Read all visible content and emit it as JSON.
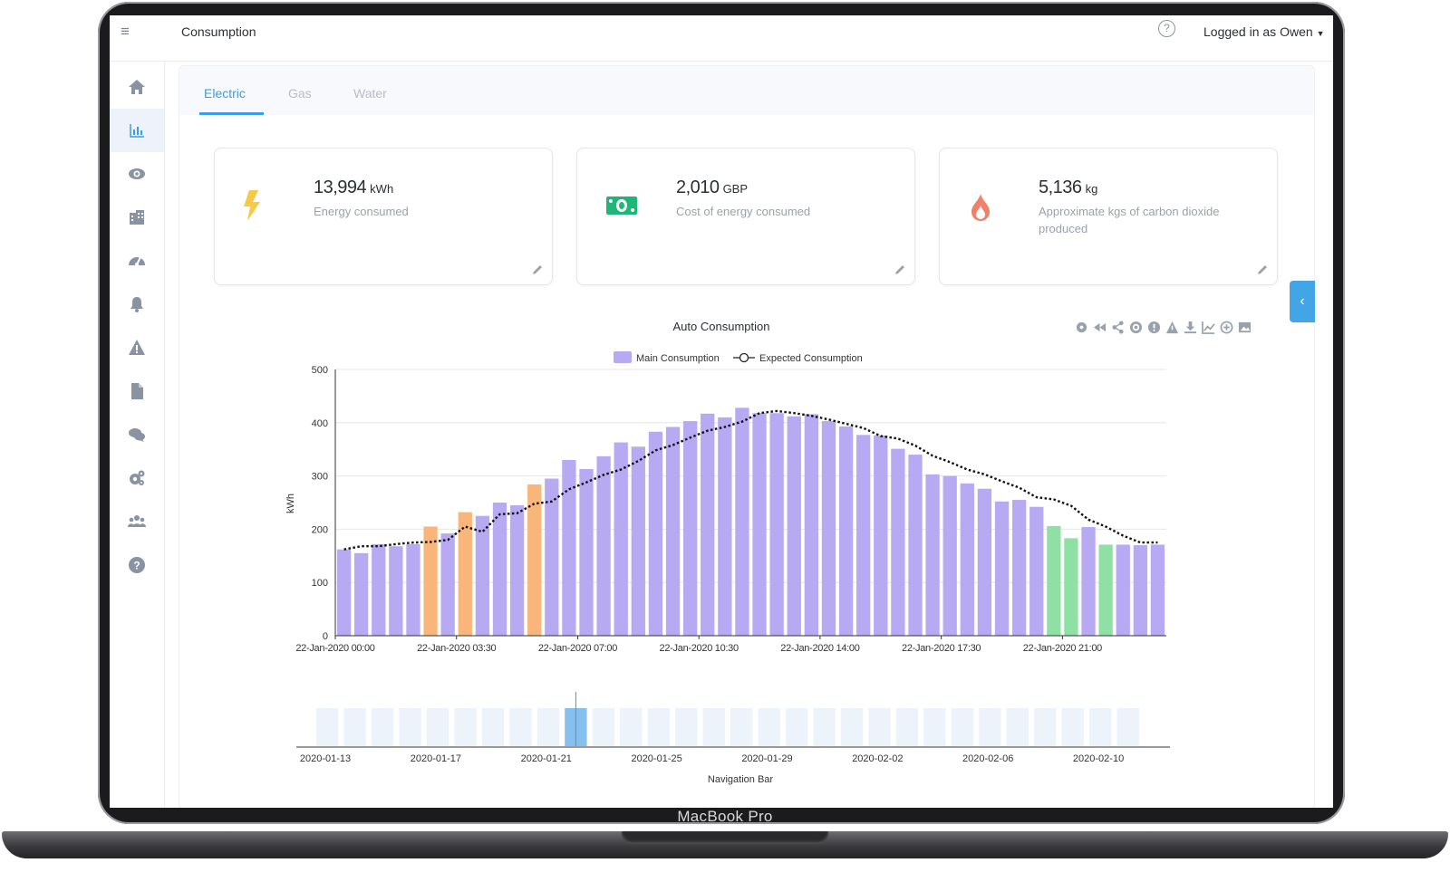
{
  "device": {
    "brand_label": "MacBook Pro"
  },
  "header": {
    "menu_icon": "hamburger-icon",
    "title": "Consumption",
    "help_icon": "help-circle-icon",
    "user_label": "Logged in as Owen"
  },
  "sidebar": {
    "items": [
      {
        "icon": "home-icon"
      },
      {
        "icon": "bar-chart-icon",
        "active": true
      },
      {
        "icon": "eye-icon"
      },
      {
        "icon": "building-icon"
      },
      {
        "icon": "dashboard-gauge-icon"
      },
      {
        "icon": "bell-icon"
      },
      {
        "icon": "warning-icon"
      },
      {
        "icon": "document-icon"
      },
      {
        "icon": "chat-icon"
      },
      {
        "icon": "cogs-icon"
      },
      {
        "icon": "users-icon"
      },
      {
        "icon": "question-icon"
      }
    ]
  },
  "tabs": [
    {
      "label": "Electric",
      "active": true
    },
    {
      "label": "Gas",
      "active": false
    },
    {
      "label": "Water",
      "active": false
    }
  ],
  "cards": [
    {
      "value": "13,994",
      "unit": "kWh",
      "label": "Energy consumed",
      "icon": "lightning-icon",
      "icon_color": "#f7c948"
    },
    {
      "value": "2,010",
      "unit": "GBP",
      "label": "Cost of energy consumed",
      "icon": "money-icon",
      "icon_color": "#1fb67a"
    },
    {
      "value": "5,136",
      "unit": "kg",
      "label": "Approximate kgs of carbon dioxide produced",
      "icon": "flame-icon",
      "icon_color": "#f0806a"
    }
  ],
  "colors": {
    "accent": "#3a9ee0",
    "bar_main": "#b7a9f2",
    "bar_orange": "#f8b67a",
    "bar_green": "#8ee0a4",
    "nav_bar": "#edf3fb",
    "nav_bar_selected": "#87c0ef"
  },
  "chart_data": {
    "type": "bar",
    "title": "Auto Consumption",
    "ylabel": "kWh",
    "ylim": [
      0,
      500
    ],
    "yticks": [
      0,
      100,
      200,
      300,
      400,
      500
    ],
    "legend": [
      "Main Consumption",
      "Expected Consumption"
    ],
    "x_tick_labels": [
      "22-Jan-2020 00:00",
      "22-Jan-2020 03:30",
      "22-Jan-2020 07:00",
      "22-Jan-2020 10:30",
      "22-Jan-2020 14:00",
      "22-Jan-2020 17:30",
      "22-Jan-2020 21:00"
    ],
    "series": [
      {
        "name": "Main Consumption",
        "values": [
          162,
          155,
          172,
          168,
          172,
          205,
          192,
          232,
          225,
          250,
          245,
          284,
          295,
          330,
          313,
          337,
          363,
          355,
          383,
          392,
          403,
          417,
          410,
          428,
          418,
          418,
          412,
          416,
          403,
          393,
          377,
          376,
          351,
          340,
          303,
          300,
          286,
          276,
          252,
          255,
          242,
          206,
          183,
          204,
          171,
          171,
          170,
          171
        ],
        "highlight": {
          "orange": [
            5,
            7,
            11
          ],
          "green": [
            41,
            42,
            44
          ]
        }
      },
      {
        "name": "Expected Consumption",
        "values": [
          162,
          168,
          168,
          172,
          175,
          176,
          180,
          205,
          195,
          228,
          230,
          248,
          252,
          275,
          288,
          302,
          312,
          328,
          348,
          358,
          372,
          385,
          392,
          402,
          418,
          422,
          418,
          413,
          406,
          398,
          390,
          375,
          370,
          357,
          338,
          326,
          312,
          303,
          290,
          278,
          260,
          256,
          244,
          218,
          205,
          188,
          175,
          175
        ]
      }
    ],
    "navigation": {
      "label": "Navigation Bar",
      "date_labels": [
        "2020-01-13",
        "2020-01-17",
        "2020-01-21",
        "2020-01-25",
        "2020-01-29",
        "2020-02-02",
        "2020-02-06",
        "2020-02-10"
      ],
      "bar_count": 30,
      "selected_index": 9
    }
  }
}
